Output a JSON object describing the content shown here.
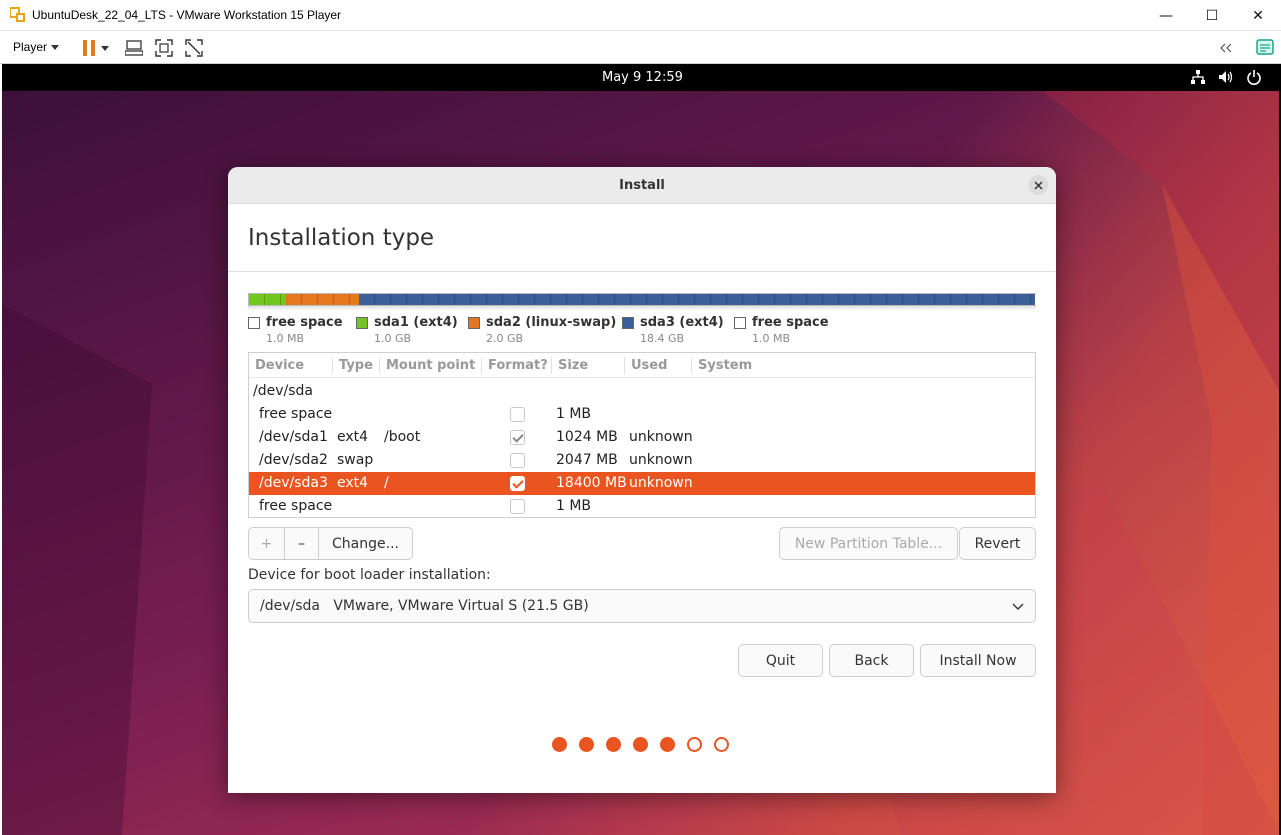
{
  "vmware": {
    "window_title": "UbuntuDesk_22_04_LTS - VMware Workstation 15 Player",
    "player_menu": "Player",
    "window_controls": {
      "minimize": "—",
      "maximize": "☐",
      "close": "✕"
    }
  },
  "gnome_topbar": {
    "clock": "May 9  12:59"
  },
  "install_dialog": {
    "title": "Install",
    "page_title": "Installation type",
    "partition_bar": [
      {
        "name": "free space",
        "size": "1.0 MB",
        "color": "#ffffff",
        "fraction": 0.0001
      },
      {
        "name": "sda1 (ext4)",
        "size": "1.0 GB",
        "color": "#73c61f",
        "fraction": 0.0465
      },
      {
        "name": "sda2 (linux-swap)",
        "size": "2.0 GB",
        "color": "#e8761f",
        "fraction": 0.093
      },
      {
        "name": "sda3 (ext4)",
        "size": "18.4 GB",
        "color": "#3a5f98",
        "fraction": 0.8604
      },
      {
        "name": "free space",
        "size": "1.0 MB",
        "color": "#ffffff",
        "fraction": 0.0001
      }
    ],
    "table": {
      "columns": [
        "Device",
        "Type",
        "Mount point",
        "Format?",
        "Size",
        "Used",
        "System"
      ],
      "disk": "/dev/sda",
      "rows": [
        {
          "device": "free space",
          "type": "",
          "mount": "",
          "format": false,
          "size": "1 MB",
          "used": "",
          "selected": false
        },
        {
          "device": "/dev/sda1",
          "type": "ext4",
          "mount": "/boot",
          "format": true,
          "size": "1024 MB",
          "used": "unknown",
          "selected": false
        },
        {
          "device": "/dev/sda2",
          "type": "swap",
          "mount": "",
          "format": false,
          "size": "2047 MB",
          "used": "unknown",
          "selected": false
        },
        {
          "device": "/dev/sda3",
          "type": "ext4",
          "mount": "/",
          "format": true,
          "size": "18400 MB",
          "used": "unknown",
          "selected": true
        },
        {
          "device": "free space",
          "type": "",
          "mount": "",
          "format": false,
          "size": "1 MB",
          "used": "",
          "selected": false
        }
      ]
    },
    "buttons": {
      "add": "+",
      "remove": "–",
      "change": "Change...",
      "new_partition_table": "New Partition Table...",
      "revert": "Revert",
      "quit": "Quit",
      "back": "Back",
      "install_now": "Install Now"
    },
    "boot_loader": {
      "label": "Device for boot loader installation:",
      "selected": "/dev/sda   VMware, VMware Virtual S (21.5 GB)"
    },
    "progress": {
      "total_steps": 7,
      "completed_steps": 5
    },
    "accent_color": "#e95420"
  }
}
